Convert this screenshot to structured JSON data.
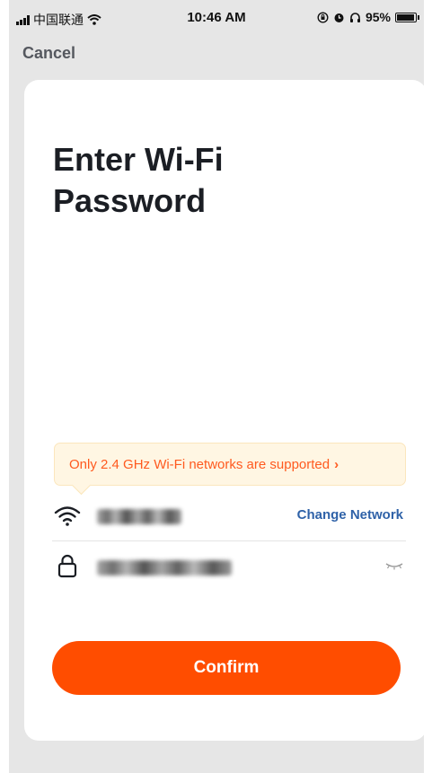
{
  "status_bar": {
    "carrier": "中国联通",
    "time": "10:46 AM",
    "battery": "95%",
    "battery_level": 0.95
  },
  "nav": {
    "cancel_label": "Cancel"
  },
  "page": {
    "title": "Enter Wi-Fi Password"
  },
  "notice": {
    "text": "Only 2.4 GHz Wi-Fi networks are supported",
    "chevron": "›",
    "color": "#ff5a1f"
  },
  "network": {
    "icon": "wifi-icon",
    "change_label": "Change Network"
  },
  "password": {
    "icon": "lock-icon",
    "toggle_icon": "eye-closed-icon"
  },
  "actions": {
    "confirm_label": "Confirm",
    "accent": "#ff4d00"
  }
}
